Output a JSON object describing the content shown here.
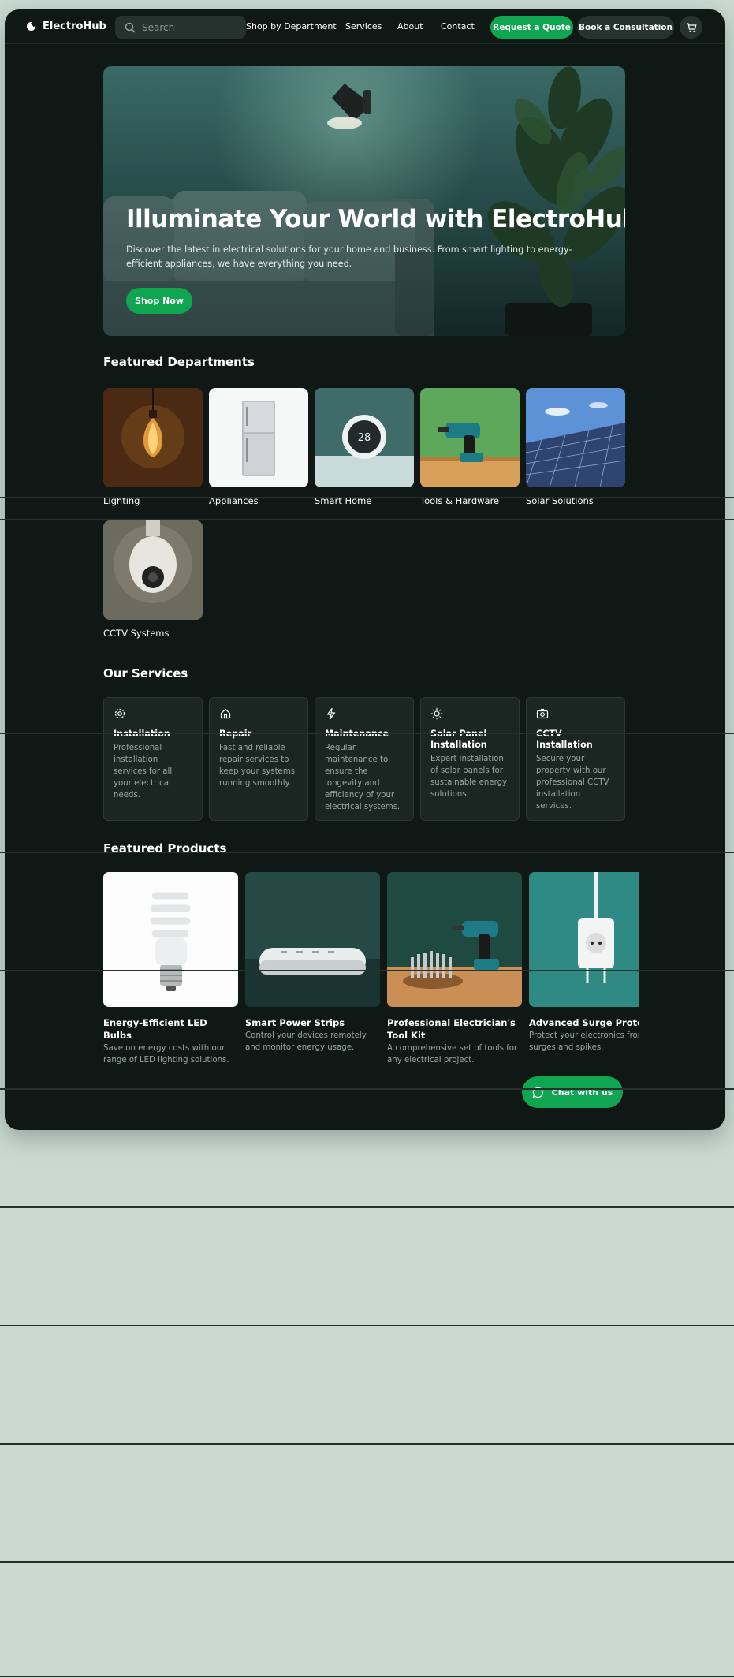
{
  "header": {
    "logo_text": "ElectroHub",
    "search_placeholder": "Search",
    "nav": [
      "Shop by Department",
      "Services",
      "About",
      "Contact"
    ],
    "quote_label": "Request a Quote",
    "consult_label": "Book a Consultation",
    "cart_icon": "cart-icon"
  },
  "hero": {
    "title": "Illuminate Your World with ElectroHub",
    "subtitle": "Discover the latest in electrical solutions for your home and business. From smart lighting to energy-efficient appliances, we have everything you need.",
    "cta": "Shop Now"
  },
  "departments": {
    "title": "Featured Departments",
    "items": [
      "Lighting",
      "Appliances",
      "Smart Home",
      "Tools & Hardware",
      "Solar Solutions",
      "CCTV Systems"
    ],
    "thermostat_reading": "28"
  },
  "services": {
    "title": "Our Services",
    "items": [
      {
        "icon": "gear-icon",
        "title": "Installation",
        "desc": "Professional installation services for all your electrical needs."
      },
      {
        "icon": "home-icon",
        "title": "Repair",
        "desc": "Fast and reliable repair services to keep your systems running smoothly."
      },
      {
        "icon": "bolt-icon",
        "title": "Maintenance",
        "desc": "Regular maintenance to ensure the longevity and efficiency of your electrical systems."
      },
      {
        "icon": "sun-icon",
        "title": "Solar Panel Installation",
        "desc": "Expert installation of solar panels for sustainable energy solutions."
      },
      {
        "icon": "camera-icon",
        "title": "CCTV Installation",
        "desc": "Secure your property with our professional CCTV installation services."
      }
    ]
  },
  "products": {
    "title": "Featured Products",
    "items": [
      {
        "title": "Energy-Efficient LED Bulbs",
        "desc": "Save on energy costs with our range of LED lighting solutions."
      },
      {
        "title": "Smart Power Strips",
        "desc": "Control your devices remotely and monitor energy usage."
      },
      {
        "title": "Professional Electrician's Tool Kit",
        "desc": "A comprehensive set of tools for any electrical project."
      },
      {
        "title": "Advanced Surge Protector",
        "desc": "Protect your electronics from power surges and spikes."
      }
    ]
  },
  "chat": {
    "label": "Chat with us",
    "icon": "chat-icon"
  },
  "colors": {
    "accent": "#10a651",
    "surface": "#0f1814",
    "page_background": "#c8dad2"
  }
}
